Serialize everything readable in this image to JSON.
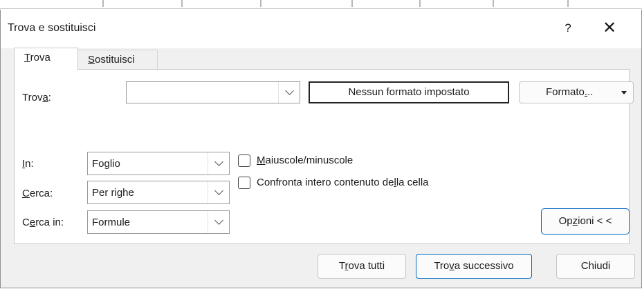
{
  "window": {
    "title": "Trova e sostituisci",
    "help_label": "?",
    "close_label": "✕"
  },
  "tabs": [
    {
      "label": "Trova",
      "access_key": "T",
      "rest": "rova",
      "active": true
    },
    {
      "label": "Sostituisci",
      "access_key": "S",
      "rest": "ostituisci",
      "active": false
    }
  ],
  "find": {
    "label_pre": "Trov",
    "label_key": "a",
    "label_post": ":",
    "value": "",
    "format_preview": "Nessun formato impostato",
    "format_button_pre": "Formato",
    "format_button_key": ".",
    "format_button_post": ".."
  },
  "options": {
    "in": {
      "label_key": "I",
      "label_rest": "n:",
      "value": "Foglio"
    },
    "search": {
      "label_key": "C",
      "label_rest": "erca:",
      "value": "Per righe"
    },
    "look_in": {
      "label_pre": "C",
      "label_key": "e",
      "label_post": "rca in:",
      "value": "Formule"
    },
    "match_case": {
      "label_key": "M",
      "label_rest": "aiuscole/minuscole",
      "checked": false
    },
    "match_entire": {
      "label_pre": "Confronta intero contenuto de",
      "label_key": "l",
      "label_post": "la cella",
      "checked": false
    },
    "options_button_pre": "Op",
    "options_button_key": "z",
    "options_button_post": "ioni < <"
  },
  "buttons": {
    "find_all_pre": "T",
    "find_all_key": "r",
    "find_all_post": "ova tutti",
    "find_next_pre": "Tro",
    "find_next_key": "v",
    "find_next_post": "a successivo",
    "close": "Chiudi"
  },
  "colors": {
    "accent": "#0067c0",
    "dialog_bg": "#f0f0f0"
  }
}
